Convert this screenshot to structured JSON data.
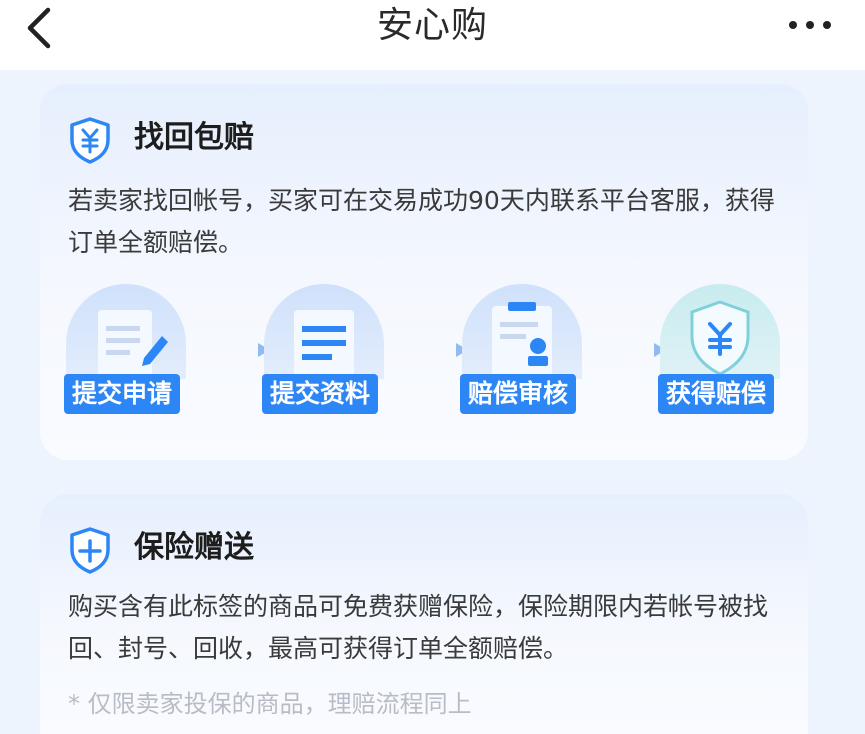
{
  "nav": {
    "title": "安心购"
  },
  "cards": [
    {
      "title": "找回包赔",
      "description": "若卖家找回帐号，买家可在交易成功90天内联系平台客服，获得订单全额赔偿。",
      "steps": [
        {
          "label": "提交申请",
          "icon": "edit-document-icon"
        },
        {
          "label": "提交资料",
          "icon": "document-lines-icon"
        },
        {
          "label": "赔偿审核",
          "icon": "review-stamp-icon"
        },
        {
          "label": "获得赔偿",
          "icon": "yuan-shield-icon"
        }
      ]
    },
    {
      "title": "保险赠送",
      "description": "购买含有此标签的商品可免费获赠保险，保险期限内若帐号被找回、封号、回收，最高可获得订单全额赔偿。",
      "note": "* 仅限卖家投保的商品，理赔流程同上"
    }
  ],
  "colors": {
    "accent": "#2d86f5",
    "page_background": "#eef4fd",
    "card_background": "#e6effd",
    "note_text": "#b8bcc6"
  }
}
